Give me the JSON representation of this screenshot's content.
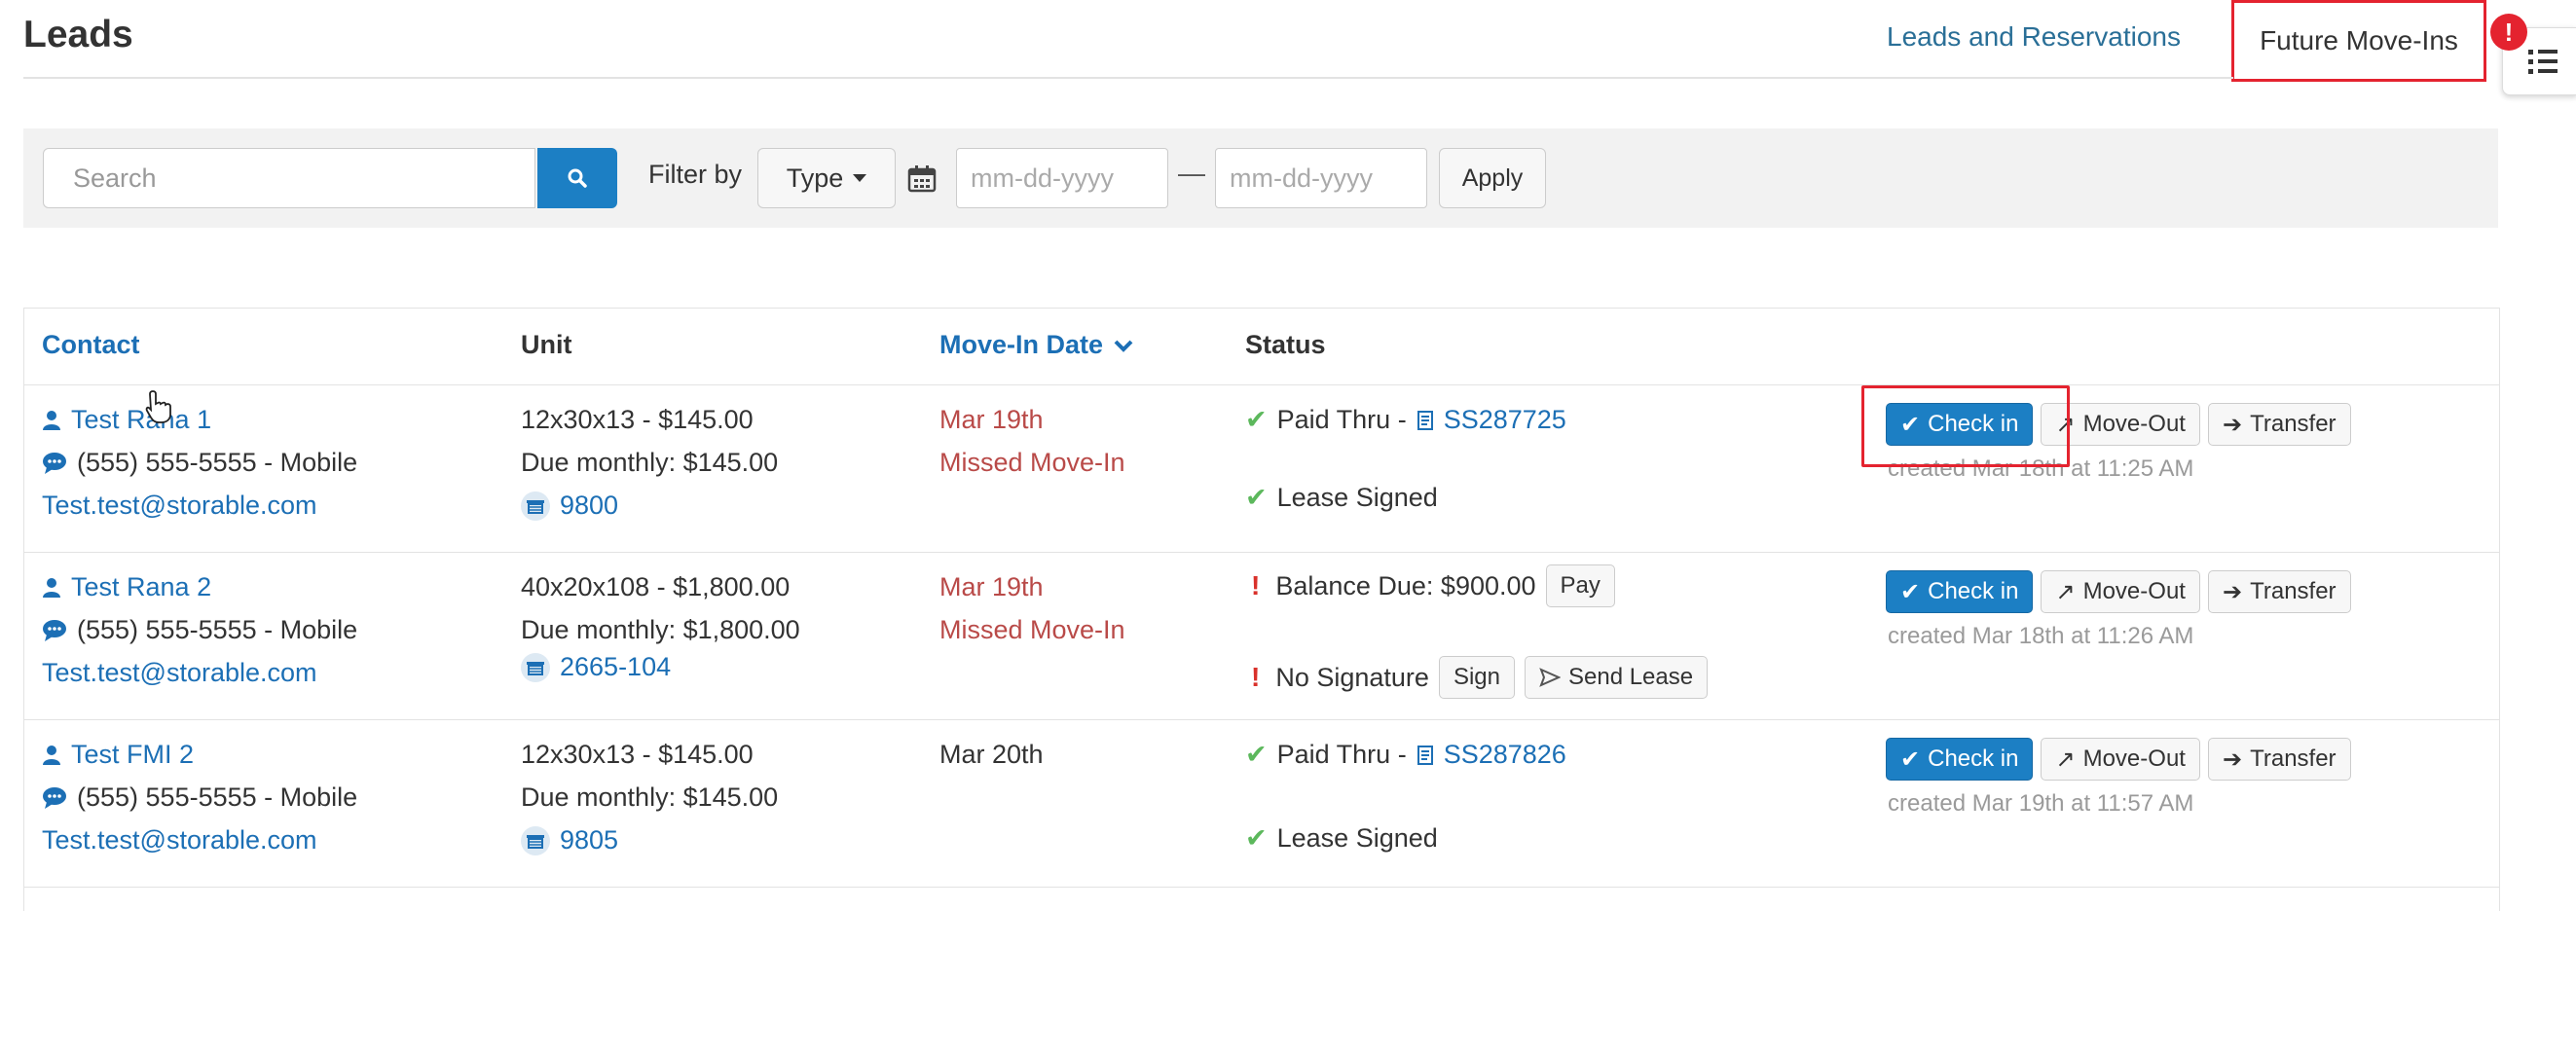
{
  "header": {
    "title": "Leads",
    "nav": [
      {
        "label": "Leads and Reservations"
      },
      {
        "label": "Future Move-Ins"
      }
    ],
    "alert_badge": "!",
    "side_toggle_icon": "list-icon"
  },
  "filters": {
    "search_placeholder": "Search",
    "filter_by_label": "Filter by",
    "type_label": "Type",
    "date_from_placeholder": "mm-dd-yyyy",
    "date_separator": "—",
    "date_to_placeholder": "mm-dd-yyyy",
    "apply_label": "Apply"
  },
  "table": {
    "columns": {
      "contact": "Contact",
      "unit": "Unit",
      "move_in_date": "Move-In Date",
      "status": "Status"
    },
    "rows": [
      {
        "name": "Test Rana 1",
        "phone": "(555) 555-5555 - Mobile",
        "email": "Test.test@storable.com",
        "unit_desc": "12x30x13 - $145.00",
        "due_monthly": "Due monthly: $145.00",
        "unit_number": "9800",
        "move_in": "Mar 19th",
        "move_in_note": "Missed Move-In",
        "status1_label": "Paid Thru -",
        "status1_link": "SS287725",
        "status2_label": "Lease Signed",
        "created": "created Mar 18th at 11:25 AM"
      },
      {
        "name": "Test Rana 2",
        "phone": "(555) 555-5555 - Mobile",
        "email": "Test.test@storable.com",
        "unit_desc": "40x20x108 - $1,800.00",
        "due_monthly": "Due monthly: $1,800.00",
        "unit_number": "2665-104",
        "move_in": "Mar 19th",
        "move_in_note": "Missed Move-In",
        "status1_label": "Balance Due: $900.00",
        "status1_btn": "Pay",
        "status2_label": "No Signature",
        "status2_btn1": "Sign",
        "status2_btn2": "Send Lease",
        "created": "created Mar 18th at 11:26 AM"
      },
      {
        "name": "Test FMI 2",
        "phone": "(555) 555-5555 - Mobile",
        "email": "Test.test@storable.com",
        "unit_desc": "12x30x13 - $145.00",
        "due_monthly": "Due monthly: $145.00",
        "unit_number": "9805",
        "move_in": "Mar 20th",
        "status1_label": "Paid Thru -",
        "status1_link": "SS287826",
        "status2_label": "Lease Signed",
        "created": "created Mar 19th at 11:57 AM"
      }
    ],
    "actions": {
      "check_in": "Check in",
      "move_out": "Move-Out",
      "transfer": "Transfer"
    }
  },
  "colors": {
    "primary": "#1c7fc4",
    "link": "#1c6fb5",
    "missed": "#b94a48",
    "success": "#5cb85c",
    "highlight": "#e4232f"
  }
}
